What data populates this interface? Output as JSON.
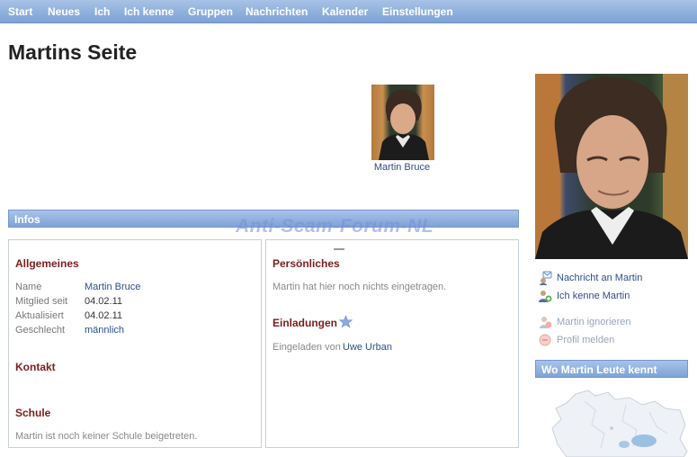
{
  "nav": {
    "items": [
      "Start",
      "Neues",
      "Ich",
      "Ich kenne",
      "Gruppen",
      "Nachrichten",
      "Kalender",
      "Einstellungen"
    ]
  },
  "page": {
    "title": "Martins Seite"
  },
  "friend": {
    "name": "Martin Bruce"
  },
  "watermark": "Anti-Scam-Forum-NL",
  "infos": {
    "header": "Infos"
  },
  "allgemeines": {
    "title": "Allgemeines",
    "rows": [
      {
        "label": "Name",
        "value": "Martin Bruce"
      },
      {
        "label": "Mitglied seit",
        "value": "04.02.11"
      },
      {
        "label": "Aktualisiert",
        "value": "04.02.11"
      },
      {
        "label": "Geschlecht",
        "value": "männlich"
      }
    ]
  },
  "kontakt": {
    "title": "Kontakt"
  },
  "schule": {
    "title": "Schule",
    "text": "Martin ist noch keiner Schule beigetreten."
  },
  "persoenliches": {
    "title": "Persönliches",
    "text": "Martin hat hier noch nichts eingetragen."
  },
  "einladungen": {
    "title": "Einladungen",
    "label": "Eingeladen von",
    "inviter": "Uwe Urban"
  },
  "actions": {
    "message": "Nachricht an Martin",
    "know": "Ich kenne Martin",
    "ignore": "Martin ignorieren",
    "report": "Profil melden"
  },
  "map": {
    "header": "Wo Martin Leute kennt"
  },
  "colors": {
    "accent": "#7ea3d6",
    "section_title": "#7a1d1d",
    "link": "#2d4e8a"
  }
}
